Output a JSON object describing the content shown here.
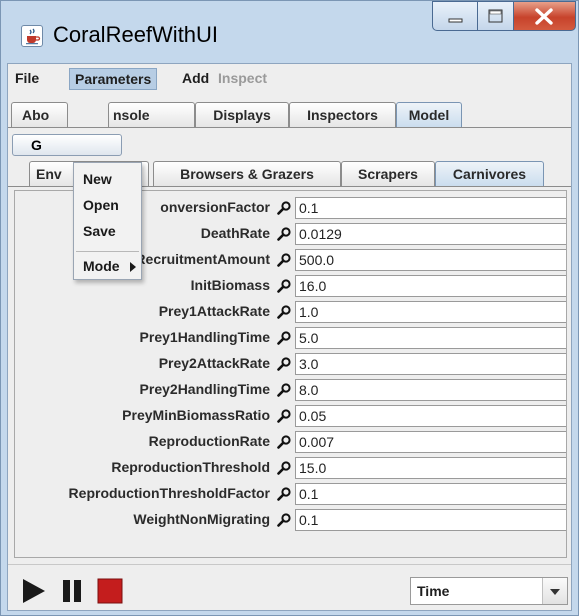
{
  "window": {
    "title": "CoralReefWithUI"
  },
  "menubar": {
    "items": [
      "File",
      "Parameters",
      "Add",
      "Inspect"
    ]
  },
  "main_tabs": [
    "Abo",
    "nsole",
    "Displays",
    "Inspectors",
    "Model"
  ],
  "go_button": {
    "label": "G"
  },
  "sub_tabs": [
    "Env",
    "Browsers & Grazers",
    "Scrapers",
    "Carnivores"
  ],
  "parameters_menu": {
    "items": [
      "New",
      "Open",
      "Save",
      "Mode"
    ]
  },
  "params": [
    {
      "name": "onversionFactor",
      "value": "0.1"
    },
    {
      "name": "DeathRate",
      "value": "0.0129"
    },
    {
      "name": "ExternalRecruitmentAmount",
      "value": "500.0"
    },
    {
      "name": "InitBiomass",
      "value": "16.0"
    },
    {
      "name": "Prey1AttackRate",
      "value": "1.0"
    },
    {
      "name": "Prey1HandlingTime",
      "value": "5.0"
    },
    {
      "name": "Prey2AttackRate",
      "value": "3.0"
    },
    {
      "name": "Prey2HandlingTime",
      "value": "8.0"
    },
    {
      "name": "PreyMinBiomassRatio",
      "value": "0.05"
    },
    {
      "name": "ReproductionRate",
      "value": "0.007"
    },
    {
      "name": "ReproductionThreshold",
      "value": "15.0"
    },
    {
      "name": "ReproductionThresholdFactor",
      "value": "0.1"
    },
    {
      "name": "WeightNonMigrating",
      "value": "0.1"
    }
  ],
  "bottom": {
    "time_select": "Time"
  },
  "icons": {
    "app": "java-coffee-icon",
    "param": "magnifier-icon",
    "play": "play-icon",
    "pause": "pause-icon",
    "stop": "stop-icon",
    "dropdown": "chevron-down-icon",
    "submenu": "triangle-right-icon"
  },
  "colors": {
    "chrome": "#c4d8ec",
    "selected_tab": "#c9dcee",
    "stop": "#c41d1d",
    "close": "#c7432b"
  }
}
